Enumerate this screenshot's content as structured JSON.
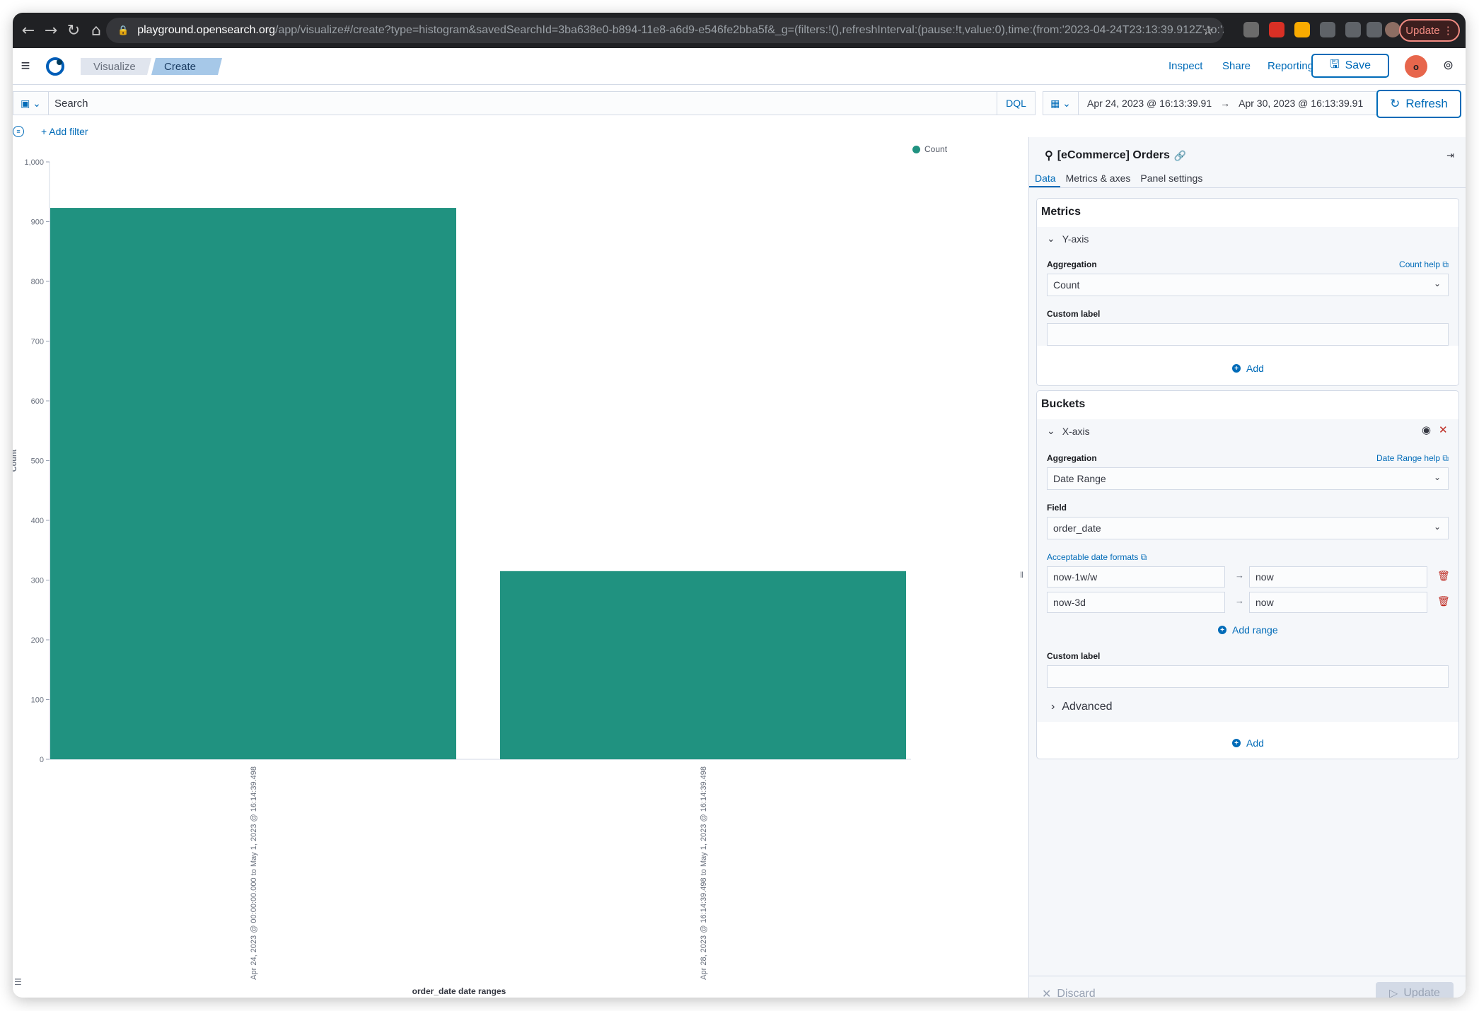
{
  "browser": {
    "url_host": "playground.opensearch.org",
    "url_path": "/app/visualize#/create?type=histogram&savedSearchId=3ba638e0-b894-11e8-a6d9-e546fe2bba5f&_g=(filters:!(),refreshInterval:(pause:!t,value:0),time:(from:'2023-04-24T23:13:39.912Z',to:'202...",
    "update_label": "Update"
  },
  "header": {
    "breadcrumbs": [
      "Visualize",
      "Create"
    ],
    "inspect_label": "Inspect",
    "share_label": "Share",
    "reporting_label": "Reporting",
    "save_label": "Save",
    "avatar_initial": "o"
  },
  "query": {
    "search_placeholder": "Search",
    "language": "DQL",
    "date_start": "Apr 24, 2023 @ 16:13:39.91",
    "date_end": "Apr 30, 2023 @ 16:13:39.91",
    "refresh_label": "Refresh",
    "add_filter_label": "+ Add filter"
  },
  "chart_data": {
    "type": "bar",
    "categories": [
      "Apr 24, 2023 @ 00:00:00.000 to May 1, 2023 @ 16:14:39.498",
      "Apr 28, 2023 @ 16:14:39.498 to May 1, 2023 @ 16:14:39.498"
    ],
    "series": [
      {
        "name": "Count",
        "values": [
          923,
          315
        ],
        "color": "#209280"
      }
    ],
    "xlabel": "order_date date ranges",
    "ylabel": "Count",
    "ylim": [
      0,
      1000
    ],
    "yticks": [
      0,
      100,
      200,
      300,
      400,
      500,
      600,
      700,
      800,
      900,
      1000
    ],
    "ytick_labels": [
      "0",
      "100",
      "200",
      "300",
      "400",
      "500",
      "600",
      "700",
      "800",
      "900",
      "1,000"
    ],
    "legend_position": "top-right",
    "grid": false
  },
  "sidebar": {
    "index_pattern": "[eCommerce] Orders",
    "tabs": [
      "Data",
      "Metrics & axes",
      "Panel settings"
    ],
    "metrics": {
      "title": "Metrics",
      "agg_title": "Y-axis",
      "aggregation_label": "Aggregation",
      "help_link": "Count help",
      "aggregation_value": "Count",
      "custom_label": "Custom label",
      "add_label": "Add"
    },
    "buckets": {
      "title": "Buckets",
      "agg_title": "X-axis",
      "aggregation_label": "Aggregation",
      "help_link": "Date Range help",
      "aggregation_value": "Date Range",
      "field_label": "Field",
      "field_value": "order_date",
      "formats_link": "Acceptable date formats",
      "ranges": [
        {
          "from": "now-1w/w",
          "to": "now"
        },
        {
          "from": "now-3d",
          "to": "now"
        }
      ],
      "add_range_label": "Add range",
      "custom_label": "Custom label",
      "advanced_label": "Advanced",
      "add_label": "Add"
    },
    "footer": {
      "discard_label": "Discard",
      "update_label": "Update"
    }
  }
}
